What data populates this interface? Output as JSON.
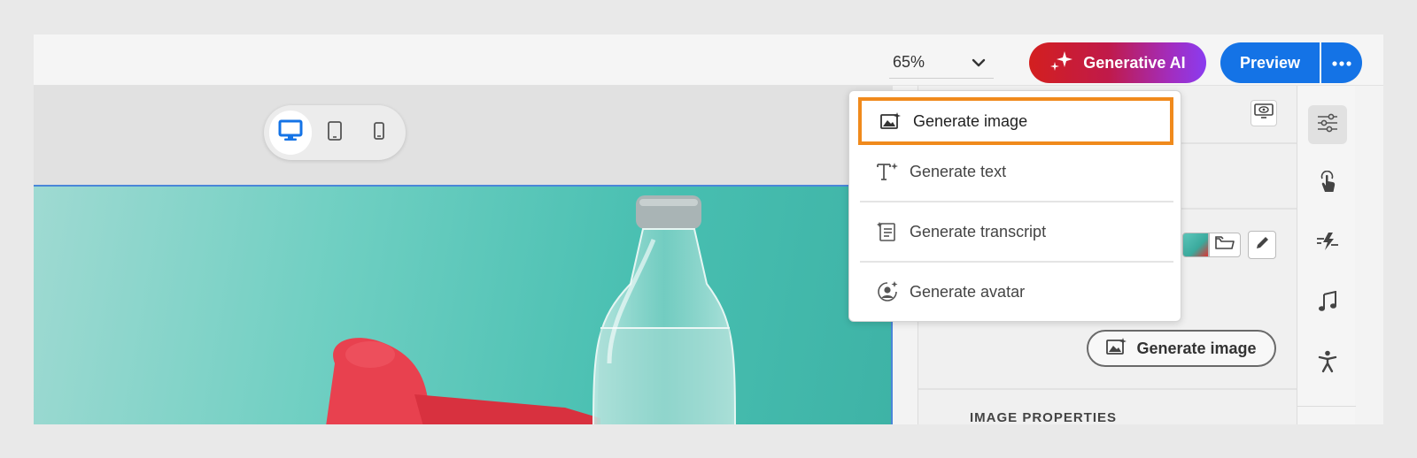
{
  "toolbar": {
    "zoom": "65%",
    "generative_ai_label": "Generative AI",
    "preview_label": "Preview",
    "brand_gradient": [
      "#d31f1f",
      "#8a3cf0"
    ],
    "accent": "#1473e6"
  },
  "device_switcher": {
    "items": [
      {
        "icon": "desktop-icon",
        "active": true
      },
      {
        "icon": "tablet-icon",
        "active": false
      },
      {
        "icon": "mobile-icon",
        "active": false
      }
    ]
  },
  "generative_menu": {
    "items": [
      {
        "label": "Generate image",
        "icon": "generate-image-icon",
        "highlighted": true
      },
      {
        "label": "Generate text",
        "icon": "generate-text-icon"
      },
      {
        "label": "Generate transcript",
        "icon": "generate-transcript-icon"
      },
      {
        "label": "Generate avatar",
        "icon": "generate-avatar-icon"
      }
    ],
    "highlight_color": "#f08a1c"
  },
  "properties_panel": {
    "generate_image_label": "Generate image",
    "section_title": "IMAGE PROPERTIES"
  },
  "side_rail": {
    "items": [
      "properties-icon",
      "interaction-icon",
      "effects-icon",
      "audio-icon",
      "accessibility-icon"
    ]
  }
}
